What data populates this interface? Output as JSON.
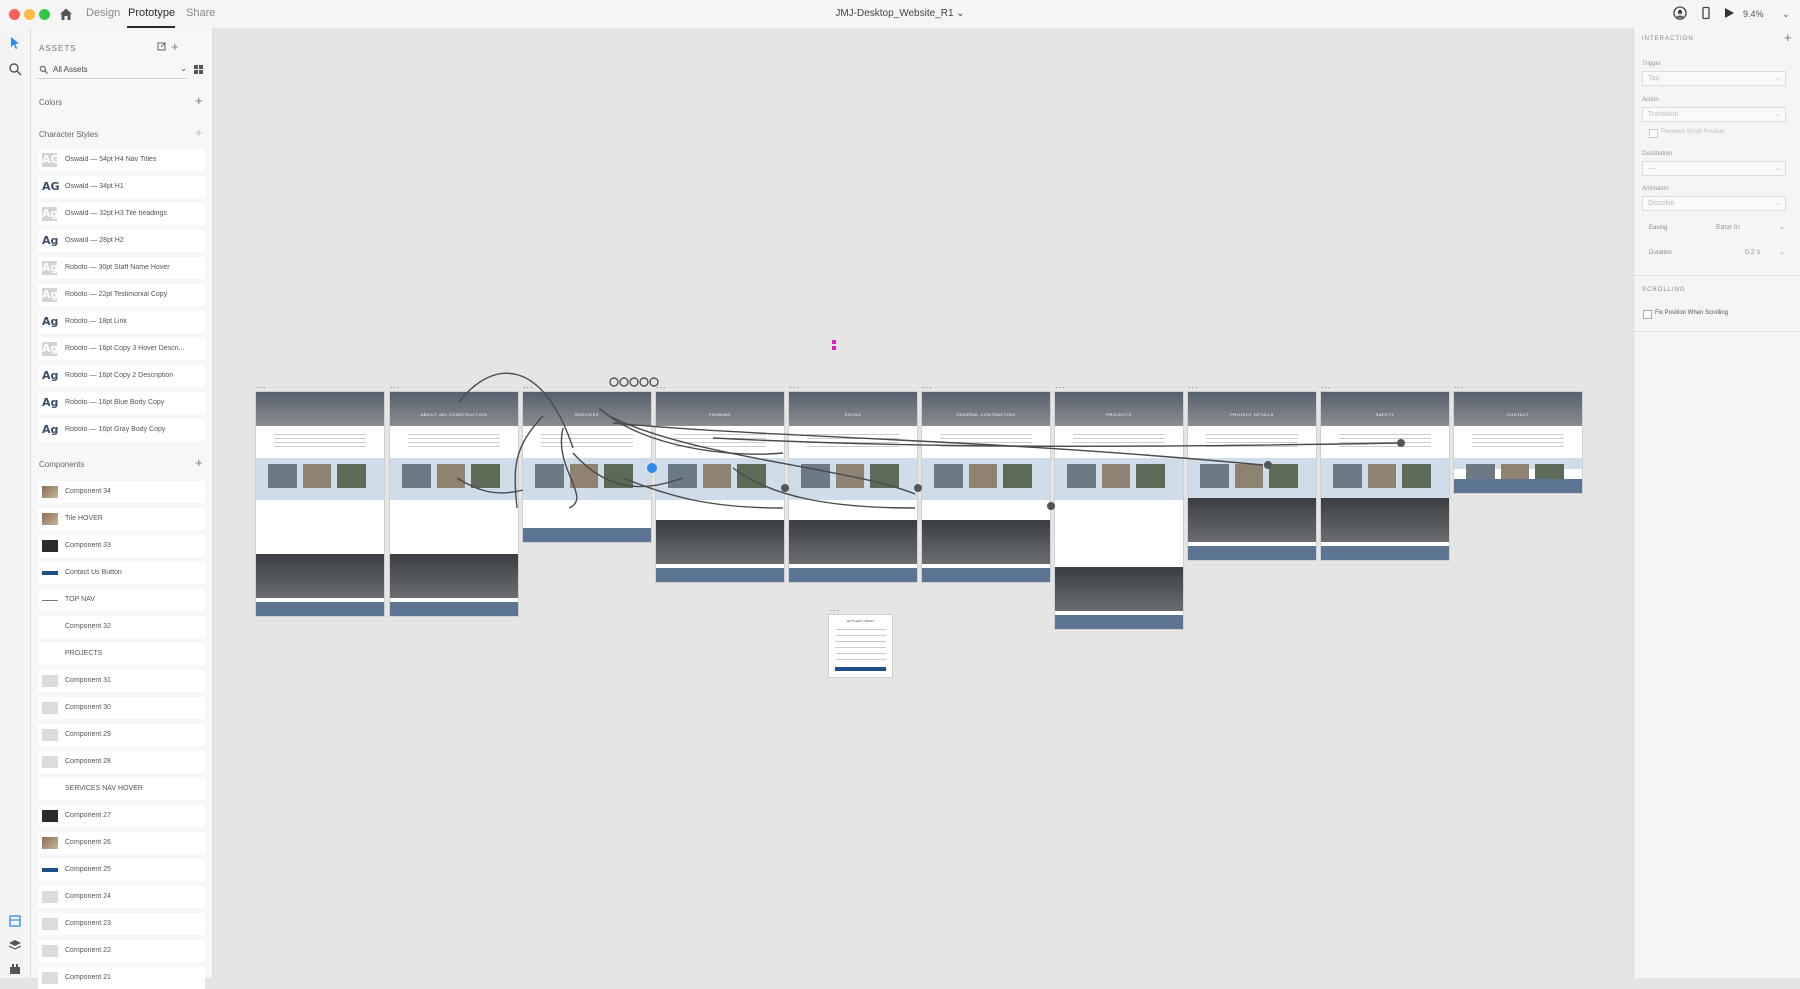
{
  "app": {
    "modes": [
      "Design",
      "Prototype",
      "Share"
    ],
    "active_mode": "Prototype",
    "doc_title": "JMJ-Desktop_Website_R1",
    "zoom": "9.4%"
  },
  "assets": {
    "title": "ASSETS",
    "search_value": "All Assets",
    "colors_label": "Colors",
    "character_styles_label": "Character Styles",
    "character_styles": [
      {
        "swatch": "AG",
        "name": "Oswald — 54pt H4 Nav Titles",
        "faded": true
      },
      {
        "swatch": "AG",
        "name": "Oswald — 34pt H1",
        "faded": false
      },
      {
        "swatch": "Ag",
        "name": "Oswald — 32pt H3 Tile headings",
        "faded": true
      },
      {
        "swatch": "Ag",
        "name": "Oswald — 28pt H2",
        "faded": false
      },
      {
        "swatch": "Ag",
        "name": "Roboto — 30pt Staff Name Hover",
        "faded": true
      },
      {
        "swatch": "Ag",
        "name": "Roboto — 22pt Testimonial Copy",
        "faded": true
      },
      {
        "swatch": "Ag",
        "name": "Roboto — 18pt Link",
        "faded": false
      },
      {
        "swatch": "Ag",
        "name": "Roboto — 16pt Copy 3 Hover Descri...",
        "faded": true
      },
      {
        "swatch": "Ag",
        "name": "Roboto — 16pt Copy 2 Description",
        "faded": false
      },
      {
        "swatch": "Ag",
        "name": "Roboto — 16pt Blue Body Copy",
        "faded": false
      },
      {
        "swatch": "Ag",
        "name": "Roboto — 16pt Gray Body Copy",
        "faded": false
      }
    ],
    "components_label": "Components",
    "components": [
      {
        "name": "Component 34",
        "thumb": "photo"
      },
      {
        "name": "Tile HOVER",
        "thumb": "photo"
      },
      {
        "name": "Component 33",
        "thumb": "dark"
      },
      {
        "name": "Contact Us Button",
        "thumb": "bar"
      },
      {
        "name": "TOP NAV",
        "thumb": "line"
      },
      {
        "name": "Component 32",
        "thumb": "none"
      },
      {
        "name": "PROJECTS",
        "thumb": "none"
      },
      {
        "name": "Component 31",
        "thumb": "grey"
      },
      {
        "name": "Component 30",
        "thumb": "grey"
      },
      {
        "name": "Component 29",
        "thumb": "grey"
      },
      {
        "name": "Component 28",
        "thumb": "grey"
      },
      {
        "name": "SERVICES NAV HOVER",
        "thumb": "none"
      },
      {
        "name": "Component 27",
        "thumb": "dark"
      },
      {
        "name": "Component 26",
        "thumb": "photo"
      },
      {
        "name": "Component 25",
        "thumb": "bar"
      },
      {
        "name": "Component 24",
        "thumb": "grey"
      },
      {
        "name": "Component 23",
        "thumb": "grey"
      },
      {
        "name": "Component 22",
        "thumb": "grey"
      },
      {
        "name": "Component 21",
        "thumb": "grey"
      }
    ]
  },
  "canvas": {
    "artboard_label": "...",
    "artboard_heroes": [
      "",
      "ABOUT JMJ CONSTRUCTION",
      "SERVICES",
      "FRAMING",
      "SIDING",
      "GENERAL CONTRACTING",
      "PROJECTS",
      "PROJECT DETAILS",
      "SAFETY",
      "CONTACT",
      "LET'S GET IT BUILT"
    ],
    "colors": {
      "accent": "#2d8ce6",
      "connector": "#4a4a4a",
      "footer": "#5b7593",
      "band": "#cfdcea",
      "pink": "#e020c0"
    }
  },
  "inspector": {
    "interaction_title": "INTERACTION",
    "trigger_label": "Trigger",
    "trigger_value": "Tap",
    "action_label": "Action",
    "action_value": "Transition",
    "preserve_scroll": "Preserve Scroll Position",
    "destination_label": "Destination",
    "destination_value": "—",
    "animation_label": "Animation",
    "animation_value": "Dissolve",
    "easing_label": "Easing",
    "easing_value": "Ease In",
    "duration_label": "Duration",
    "duration_value": "0.2 s",
    "scrolling_title": "SCROLLING",
    "fix_position": "Fix Position When Scrolling"
  }
}
